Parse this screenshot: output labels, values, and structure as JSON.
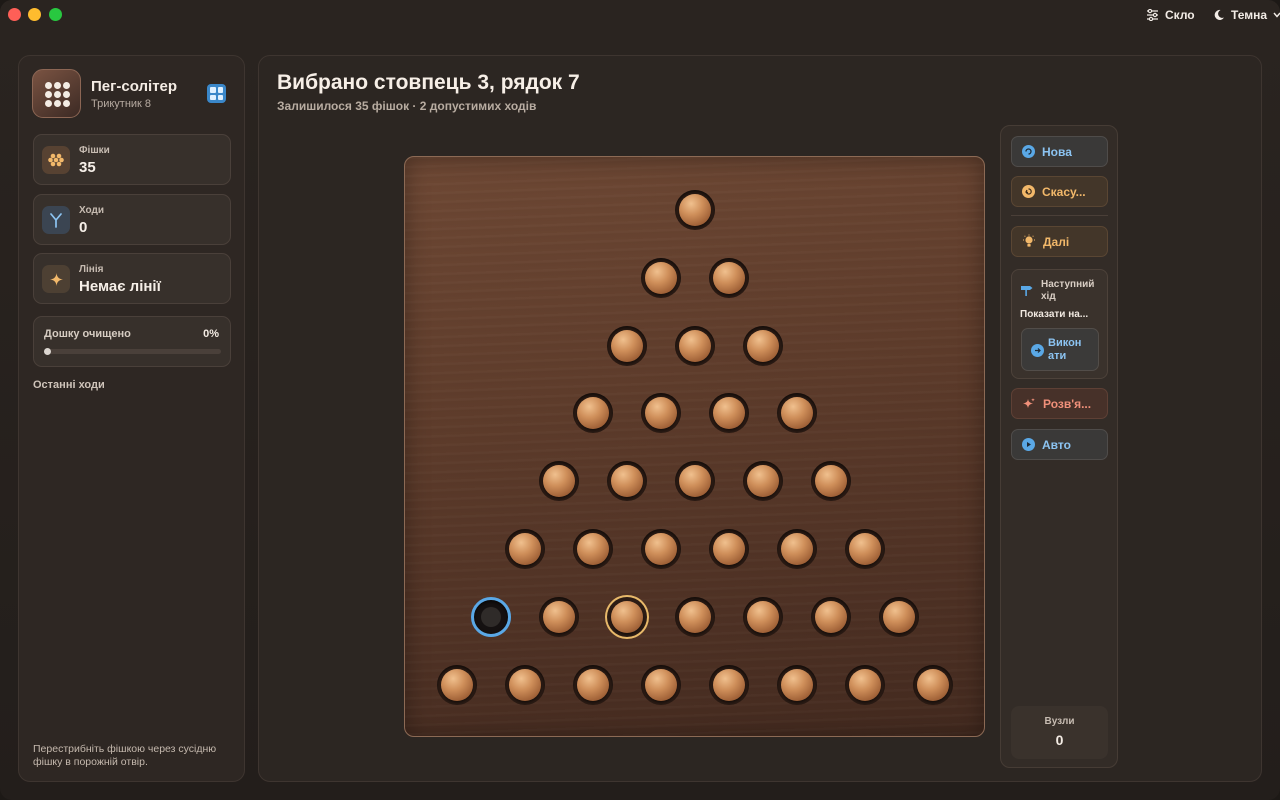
{
  "titlebar": {
    "glass_label": "Скло",
    "theme_label": "Темна"
  },
  "sidebar": {
    "app_title": "Пег-солітер",
    "app_subtitle": "Трикутник 8",
    "stats": [
      {
        "label": "Фішки",
        "value": "35",
        "icon": "pegs-cluster-icon"
      },
      {
        "label": "Ходи",
        "value": "0",
        "icon": "moves-fork-icon"
      },
      {
        "label": "Лінія",
        "value": "Немає лінії",
        "icon": "sparkle-icon"
      }
    ],
    "progress": {
      "label": "Дошку очищено",
      "percent_text": "0%",
      "value": 0
    },
    "recent_moves_label": "Останні ходи",
    "hint": "Перестрибніть фішкою через сусідню фішку в порожній отвір."
  },
  "main": {
    "title": "Вибрано стовпець 3, рядок 7",
    "subtitle": "Залишилося 35 фішок · 2 допустимих ходів"
  },
  "board": {
    "rows": 8,
    "empty_hole": {
      "row": 7,
      "col": 1
    },
    "selected_peg": {
      "row": 7,
      "col": 3
    }
  },
  "controls": {
    "new_label": "Нова",
    "undo_label": "Скасу...",
    "next_label": "Далі",
    "next_move_title": "Наступний хід",
    "show_label": "Показати на...",
    "execute_label": "Викон ати",
    "solve_label": "Розв'я...",
    "auto_label": "Авто",
    "nodes_label": "Вузли",
    "nodes_value": "0"
  },
  "colors": {
    "accent_blue": "#5aa8e6",
    "accent_orange": "#f2b86a",
    "accent_red": "#f0907a",
    "selected_ring": "#e8b96a"
  }
}
